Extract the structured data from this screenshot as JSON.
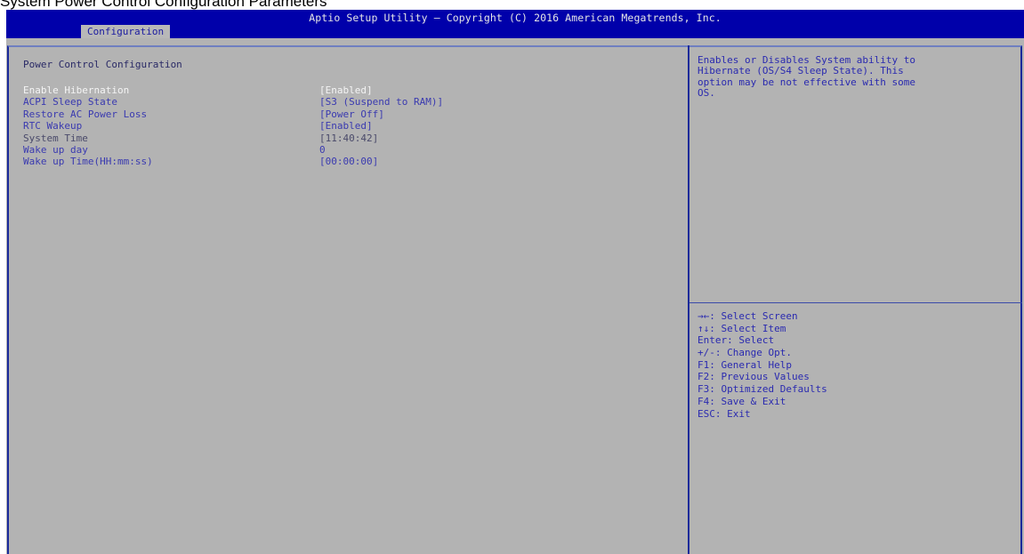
{
  "caption": "System Power Control Configuration Parameters",
  "window": {
    "title": "Aptio Setup Utility – Copyright (C) 2016 American Megatrends, Inc.",
    "active_tab": "Configuration"
  },
  "main": {
    "section_title": "Power Control Configuration",
    "items": [
      {
        "label": "Enable Hibernation",
        "value": "[Enabled]"
      },
      {
        "label": "ACPI Sleep State",
        "value": "[S3 (Suspend to RAM)]"
      },
      {
        "label": "Restore AC Power Loss",
        "value": "[Power Off]"
      },
      {
        "label": "RTC Wakeup",
        "value": "[Enabled]"
      },
      {
        "label": "System Time",
        "value": "[11:40:42]"
      },
      {
        "label": "Wake up day",
        "value": "0"
      },
      {
        "label": "Wake up Time(HH:mm:ss)",
        "value": "[00:00:00]"
      }
    ]
  },
  "help": {
    "lines": [
      "Enables or Disables System ability to",
      "Hibernate (OS/S4 Sleep State). This",
      "option may be not effective with some",
      "OS."
    ]
  },
  "keys": [
    "→←: Select Screen",
    "↑↓: Select Item",
    "Enter: Select",
    "+/-: Change Opt.",
    "F1: General Help",
    "F2: Previous Values",
    "F3: Optimized Defaults",
    "F4: Save & Exit",
    "ESC: Exit"
  ],
  "colors": {
    "title_bar": "#0000aa",
    "background": "#b3b3b3",
    "text_blue": "#3a3ab0",
    "selected_text": "#f4f4f4"
  }
}
